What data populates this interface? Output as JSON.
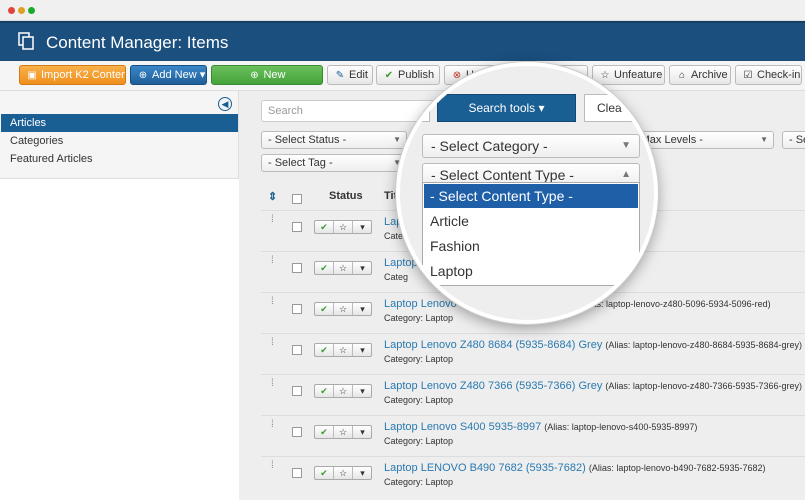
{
  "window": {
    "dots": [
      "#e0443e",
      "#dea123",
      "#1aab29"
    ]
  },
  "header": {
    "title": "Content Manager: Items"
  },
  "toolbar": {
    "import_label": "Import K2 Content",
    "addnew_label": "Add New",
    "new_label": "New",
    "edit_label": "Edit",
    "publish_label": "Publish",
    "unpublish_label": "U",
    "feature_label": "re",
    "unfeature_label": "Unfeature",
    "archive_label": "Archive",
    "checkin_label": "Check-in"
  },
  "sidebar": {
    "items": [
      {
        "label": "Articles"
      },
      {
        "label": "Categories"
      },
      {
        "label": "Featured Articles"
      }
    ]
  },
  "filters": {
    "search_placeholder": "Search",
    "status": "- Select Status -",
    "max_levels": "ct Max Levels -",
    "last": "- Se",
    "tag": "- Select Tag -"
  },
  "table": {
    "status_header": "Status",
    "title_header": "Tit"
  },
  "magnifier": {
    "search_tools": "Search tools",
    "clear": "Clea",
    "category": "- Select Category -",
    "content_type": "- Select Content Type -",
    "options": [
      "- Select Content Type -",
      "Article",
      "Fashion",
      "Laptop"
    ]
  },
  "rows": [
    {
      "title": "Lap",
      "alias": "832)",
      "category": "Categ"
    },
    {
      "title": "Laptop",
      "alias": "5-b470-7222-5931-7222)",
      "category": "Categ"
    },
    {
      "title": "Laptop Lenovo Z480 7222 (5931-7222)",
      "alias": "(Alias: laptop-lenovo-z480-5096-5934-5096-red)",
      "category": "Category: Laptop"
    },
    {
      "title": "Laptop Lenovo Z480 8684 (5935-8684) Grey",
      "alias": "(Alias: laptop-lenovo-z480-8684-5935-8684-grey)",
      "category": "Category: Laptop"
    },
    {
      "title": "Laptop Lenovo Z480 7366 (5935-7366) Grey",
      "alias": "(Alias: laptop-lenovo-z480-7366-5935-7366-grey)",
      "category": "Category: Laptop"
    },
    {
      "title": "Laptop Lenovo S400 5935-8997",
      "alias": "(Alias: laptop-lenovo-s400-5935-8997)",
      "category": "Category: Laptop"
    },
    {
      "title": "Laptop LENOVO B490 7682 (5935-7682)",
      "alias": "(Alias: laptop-lenovo-b490-7682-5935-7682)",
      "category": "Category: Laptop"
    }
  ]
}
